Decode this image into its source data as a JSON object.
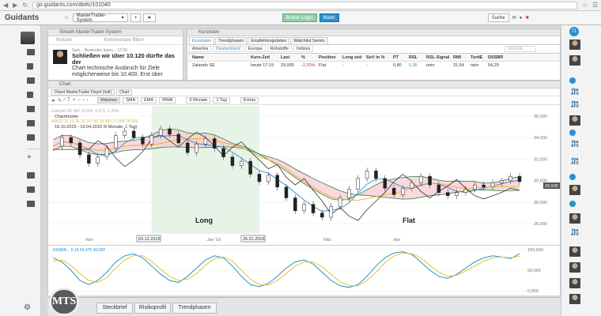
{
  "browser": {
    "url": "go.guidants.com/de#c/101040"
  },
  "app": {
    "logo": "Guidants",
    "workspace": "MasterTrader-System",
    "broker_button": "Broker Login",
    "market_button": "Markt",
    "search_label": "Suche"
  },
  "stream": {
    "title": "Stream MasterTrader-System",
    "notes_label": "Notizen",
    "comment_label": "Kommentare filtern",
    "post": {
      "meta": "Sam... Bosenden  Ipsen... 17:20",
      "headline": "Schließen wir über 10.120 dürfte das der",
      "body": "Chart technische Ausbruch für Ziele möglicherweise bis 10.400. Erst über"
    }
  },
  "kurse": {
    "title": "Kurslisten",
    "tabs": [
      "Kurslisten",
      "Trendphasen",
      "Empfehlungslisten",
      "Watchlist Semin"
    ],
    "subtabs": [
      "Amerika",
      "Deutschland",
      "Europa",
      "Rohstoffe",
      "Indizes"
    ],
    "search_placeholder": "SUCHE",
    "columns": [
      "Name",
      "Kurs-Zeit",
      "Last",
      "%",
      "Position",
      "Long seit",
      "SoV in %",
      "PT",
      "RSL",
      "RSL-Signal",
      "RMI",
      "TurtlE",
      "DSSBR"
    ],
    "rows": [
      [
        "Zalando SE",
        "heute 17:19",
        "29,905",
        "-2,20%",
        "Flat",
        "-",
        "-",
        "0,80",
        "0,95",
        "nein",
        "31,54",
        "nein",
        "54,29"
      ]
    ]
  },
  "chart_panel": {
    "title": "Chart",
    "tabs": [
      "Depot MasterTrader Depot (Indi)",
      "Chart"
    ],
    "toolbar": [
      "Volumen",
      "SMA",
      "EMA",
      "WMA",
      "6 Monate",
      "1 Tag",
      "Extras"
    ],
    "legend": [
      "Zalando SE NW  29,905 -0,671 -2,20%",
      "Chartmuster",
      "MACD 26,10  28,33 29,795  28,383  27,388  28,995",
      "19.10.2015 - 19.04.2016 (6 Monate, 1 Tag)"
    ],
    "annotations": [
      "Long",
      "Flat"
    ],
    "date_markers": [
      "03.12.2015",
      "26.01.2016"
    ],
    "x_ticks": [
      "Nov",
      "Jan '16",
      "Mär",
      "Apr"
    ],
    "y_ticks": [
      "36,000",
      "34,000",
      "32,000",
      "30,000",
      "28,000",
      "26,000"
    ],
    "last_price": "29,905",
    "osc_label": "DSSBR... 5,15  54,375  90,082",
    "osc_ticks": [
      "100,000",
      "50,000",
      "0,000"
    ]
  },
  "chart_data": {
    "type": "line",
    "xlabel": "",
    "ylabel": "",
    "ylim": [
      25.5,
      36.5
    ],
    "x_ticks": [
      "Nov",
      "Jan '16",
      "Mär",
      "Apr"
    ],
    "series": [
      {
        "values": [
          33.2,
          34.0,
          33.5,
          32.4,
          31.6,
          32.2,
          33.0,
          34.2,
          34.6,
          34.0,
          33.4,
          34.2,
          34.8,
          34.3,
          33.5,
          32.6,
          33.4,
          33.9,
          33.0,
          32.2,
          31.4,
          31.8,
          30.6,
          29.9,
          30.5,
          29.4,
          28.4,
          27.2,
          27.8,
          27.0,
          26.6,
          27.6,
          28.4,
          29.2,
          30.2,
          30.9,
          30.2,
          29.3,
          28.7,
          29.3,
          29.8,
          30.4,
          29.6,
          28.9,
          28.6,
          28.9,
          29.2,
          29.6,
          29.4,
          29.8,
          30.0,
          30.4,
          29.905
        ]
      }
    ],
    "oscillator": {
      "ylim": [
        0,
        100
      ],
      "series": [
        {
          "values": [
            80,
            70,
            50,
            25,
            15,
            25,
            45,
            70,
            85,
            90,
            80,
            60,
            40,
            25,
            20,
            35,
            55,
            75,
            85,
            80,
            60,
            35,
            15,
            10,
            18,
            35,
            55,
            70,
            75,
            65,
            45,
            25,
            12,
            8,
            15,
            35,
            60,
            80,
            92,
            95,
            88,
            70,
            50,
            35,
            30,
            40,
            55,
            70,
            80,
            85,
            82,
            78,
            90
          ]
        },
        {
          "values": [
            72,
            75,
            62,
            42,
            25,
            20,
            32,
            55,
            75,
            86,
            85,
            72,
            52,
            35,
            25,
            28,
            42,
            62,
            78,
            82,
            72,
            50,
            28,
            15,
            14,
            25,
            42,
            60,
            70,
            70,
            58,
            40,
            22,
            12,
            12,
            25,
            45,
            68,
            85,
            92,
            90,
            80,
            62,
            45,
            35,
            38,
            48,
            60,
            72,
            80,
            82,
            80,
            84
          ]
        }
      ]
    }
  },
  "bottom_tabs": [
    "Steckbrief",
    "Risikoprofil",
    "Trendphasen"
  ],
  "logo_mts": "MTS",
  "right_sidebar": {
    "notification_count": "71",
    "partner_logo": "dpa AFX"
  },
  "colors": {
    "accent": "#2a8fd0",
    "green": "#8fd0a6",
    "kijun_fill": "#f7c7d0",
    "cloud_fill": "#d6efd9"
  }
}
